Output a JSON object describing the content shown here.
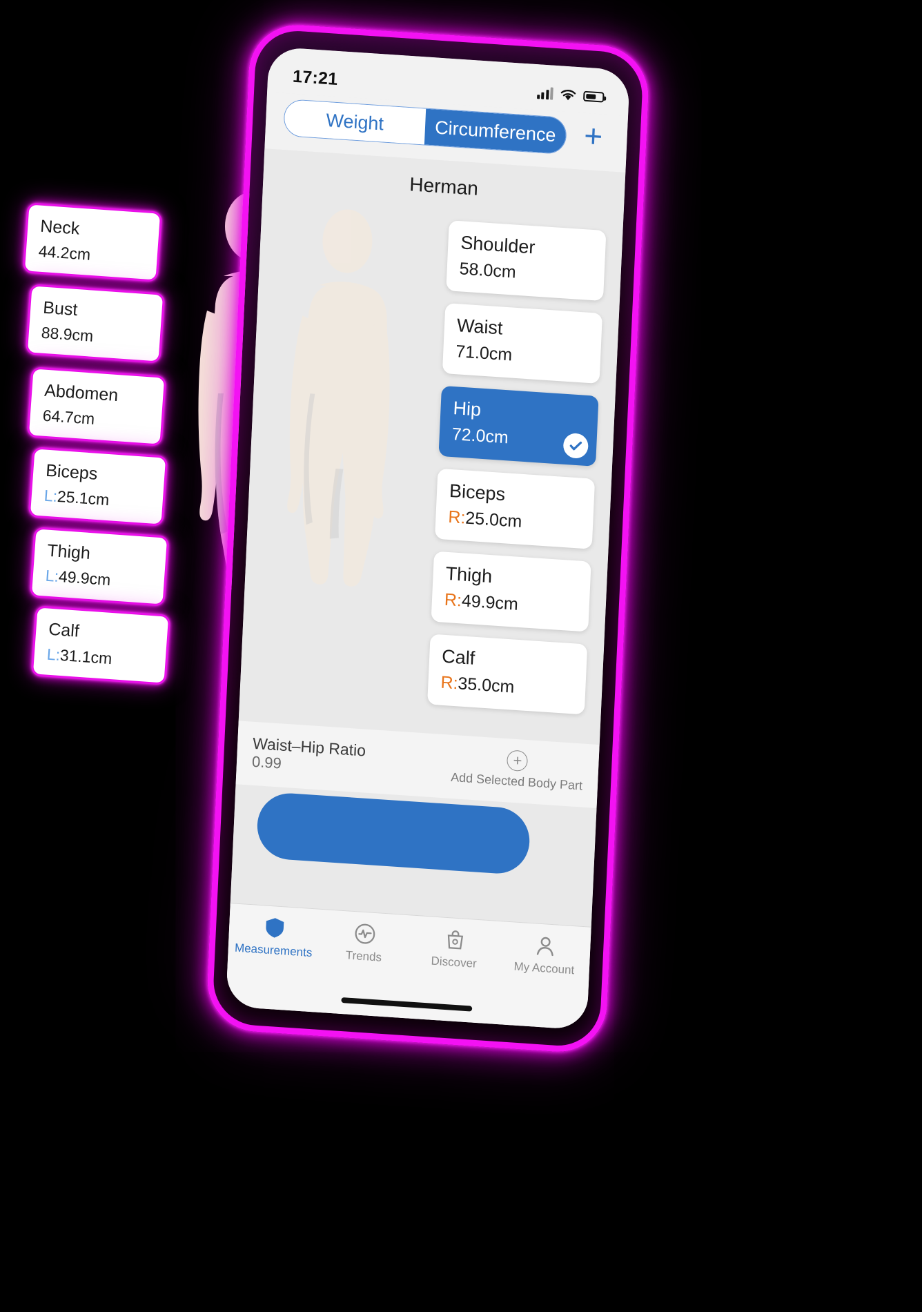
{
  "statusbar": {
    "time": "17:21",
    "signal_icon": "cellular-signal-icon",
    "wifi_icon": "wifi-icon",
    "battery_icon": "battery-icon"
  },
  "topbar": {
    "segments": [
      {
        "label": "Weight",
        "active": false
      },
      {
        "label": "Circumference",
        "active": true
      }
    ],
    "add_button_label": "+"
  },
  "header": {
    "person_name": "Herman"
  },
  "phone_cards": [
    {
      "name": "Shoulder",
      "side": "",
      "value": "58.0cm",
      "selected": false
    },
    {
      "name": "Waist",
      "side": "",
      "value": "71.0cm",
      "selected": false
    },
    {
      "name": "Hip",
      "side": "",
      "value": "72.0cm",
      "selected": true
    },
    {
      "name": "Biceps",
      "side": "R:",
      "value": "25.0cm",
      "selected": false
    },
    {
      "name": "Thigh",
      "side": "R:",
      "value": "49.9cm",
      "selected": false
    },
    {
      "name": "Calf",
      "side": "R:",
      "value": "35.0cm",
      "selected": false
    }
  ],
  "ratio_row": {
    "label": "Waist–Hip Ratio",
    "value": "0.99",
    "add_body_part_label": "Add Selected Body Part",
    "add_icon": "plus-circle-icon"
  },
  "callout_cards": [
    {
      "name": "Neck",
      "side": "",
      "value": "44.2cm"
    },
    {
      "name": "Bust",
      "side": "",
      "value": "88.9cm"
    },
    {
      "name": "Abdomen",
      "side": "",
      "value": "64.7cm"
    },
    {
      "name": "Biceps",
      "side": "L:",
      "value": "25.1cm"
    },
    {
      "name": "Thigh",
      "side": "L:",
      "value": "49.9cm"
    },
    {
      "name": "Calf",
      "side": "L:",
      "value": "31.1cm"
    }
  ],
  "tabbar": [
    {
      "label": "Measurements",
      "icon": "shield-icon",
      "active": true
    },
    {
      "label": "Trends",
      "icon": "pulse-icon",
      "active": false
    },
    {
      "label": "Discover",
      "icon": "bag-icon",
      "active": false
    },
    {
      "label": "My Account",
      "icon": "person-icon",
      "active": false
    }
  ],
  "colors": {
    "accent_blue": "#2f73c4",
    "neon_magenta": "#e90fe9",
    "left_side": "#69a6e8",
    "right_side": "#e8741a",
    "skin": "#f6e7d8"
  }
}
